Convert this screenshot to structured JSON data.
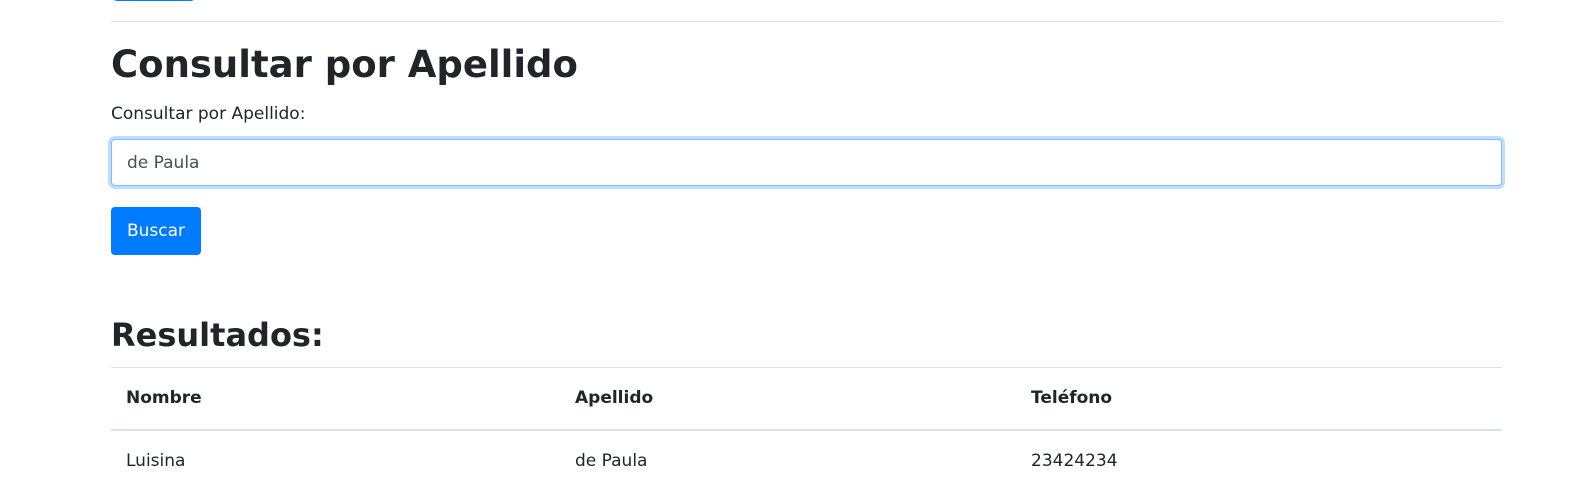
{
  "search": {
    "heading": "Consultar por Apellido",
    "label": "Consultar por Apellido:",
    "input_value": "de Paula",
    "button_label": "Buscar"
  },
  "results": {
    "heading": "Resultados:",
    "columns": [
      "Nombre",
      "Apellido",
      "Teléfono"
    ],
    "rows": [
      {
        "nombre": "Luisina",
        "apellido": "de Paula",
        "telefono": "23424234"
      }
    ]
  },
  "colors": {
    "primary": "#007bff",
    "text": "#212529",
    "border": "#dee2e6",
    "focus_border": "#80bdff"
  }
}
